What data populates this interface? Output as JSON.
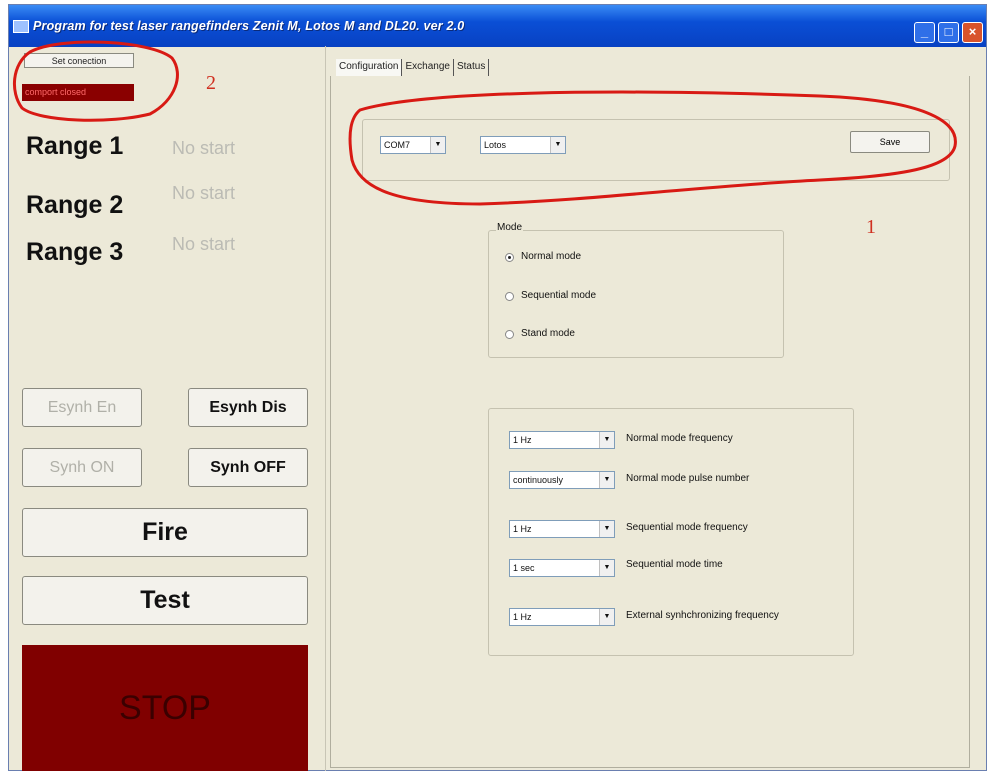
{
  "window": {
    "title": "Program for test laser rangefinders Zenit M, Lotos M and DL20.  ver 2.0"
  },
  "left": {
    "set_connection_label": "Set conection",
    "comport_status": "comport closed",
    "ranges": [
      {
        "label": "Range 1",
        "status": "No start"
      },
      {
        "label": "Range 2",
        "status": "No start"
      },
      {
        "label": "Range 3",
        "status": "No start"
      }
    ],
    "esynh_en_label": "Esynh En",
    "esynh_dis_label": "Esynh Dis",
    "synh_on_label": "Synh ON",
    "synh_off_label": "Synh OFF",
    "fire_label": "Fire",
    "test_label": "Test",
    "stop_label": "STOP"
  },
  "tabs": [
    "Configuration",
    "Exchange",
    "Status"
  ],
  "config": {
    "com_port": "COM7",
    "device": "Lotos",
    "save_label": "Save",
    "mode_legend": "Mode",
    "modes": [
      {
        "label": "Normal mode",
        "selected": true
      },
      {
        "label": "Sequential mode",
        "selected": false
      },
      {
        "label": "Stand mode",
        "selected": false
      }
    ],
    "settings": [
      {
        "value": "1 Hz",
        "label": "Normal mode  frequency"
      },
      {
        "value": "continuously",
        "label": "Normal mode  pulse number"
      },
      {
        "value": "1 Hz",
        "label": "Sequential mode frequency"
      },
      {
        "value": "1 sec",
        "label": "Sequential mode  time"
      },
      {
        "value": "1 Hz",
        "label": "External synhchronizing frequency"
      }
    ]
  },
  "annotations": {
    "one": "1",
    "two": "2"
  },
  "colors": {
    "title_bar": "#0a4fd6",
    "stop": "#800000",
    "annotation": "#d03020"
  }
}
